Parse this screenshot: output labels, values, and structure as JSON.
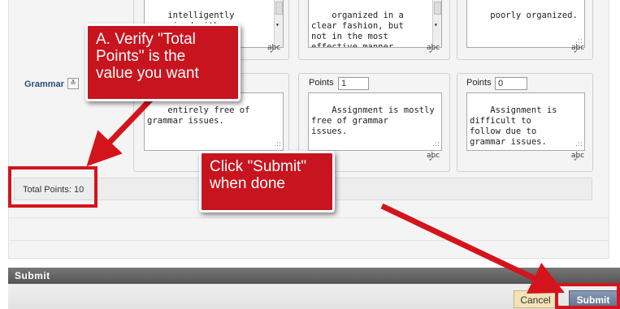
{
  "rubric": {
    "top_row": {
      "cell1_text": "intelligently\norganized with an\nd",
      "cell2_text": "organized in a\nclear fashion, but\nnot in the most\neffective manner.",
      "cell3_text": "poorly organized."
    },
    "grammar_row": {
      "label": "Grammar",
      "cell1_text": "entirely free of\ngrammar issues.",
      "cell2_points_label": "Points",
      "cell2_points_value": "1",
      "cell2_text": "Assignment is mostly\nfree of grammar\nissues.",
      "cell3_points_label": "Points",
      "cell3_points_value": "0",
      "cell3_text": "Assignment is\ndifficult to\nfollow due to\ngrammar issues."
    },
    "spellcheck_label": "abc",
    "resize_grip": ".::",
    "total_points": "Total Points: 10"
  },
  "footer": {
    "section_title": "Submit",
    "cancel_label": "Cancel",
    "submit_label": "Submit"
  },
  "annotations": {
    "callout_a": "A. Verify \"Total\nPoints\" is the\nvalue you want",
    "callout_b": "Click \"Submit\"\nwhen done",
    "color": "#c8141e"
  }
}
